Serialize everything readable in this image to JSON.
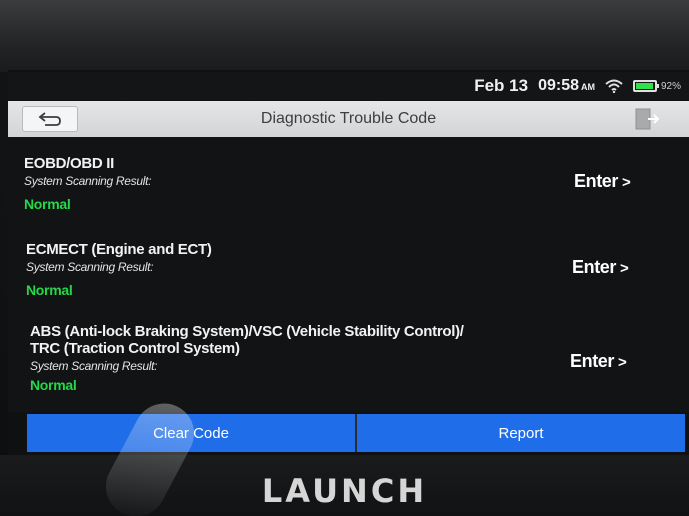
{
  "status_bar": {
    "date": "Feb 13",
    "time": "09:58",
    "ampm": "AM",
    "battery_level": 0.92,
    "battery_text": "92%"
  },
  "header": {
    "title": "Diagnostic Trouble Code"
  },
  "systems": [
    {
      "name_line1": "EOBD/OBD II",
      "name_line2": "",
      "result_label": "System Scanning Result:",
      "status": "Normal",
      "action": "Enter",
      "action_icon": ">"
    },
    {
      "name_line1": "ECMECT (Engine and ECT)",
      "name_line2": "",
      "result_label": "System Scanning Result:",
      "status": "Normal",
      "action": "Enter",
      "action_icon": ">"
    },
    {
      "name_line1": "ABS (Anti-lock Braking System)/VSC (Vehicle Stability Control)/",
      "name_line2": "TRC (Traction Control System)",
      "result_label": "System Scanning Result:",
      "status": "Normal",
      "action": "Enter",
      "action_icon": ">"
    }
  ],
  "footer": {
    "clear_code": "Clear Code",
    "report": "Report"
  },
  "device": {
    "brand": "LAUNCH"
  },
  "colors": {
    "status_ok": "#24d84a",
    "button_blue": "#1f6de8",
    "battery_green": "#2fe04a"
  },
  "icons": {
    "back": "back-arrow-icon",
    "exit": "exit-icon",
    "wifi": "wifi-icon",
    "battery": "battery-icon"
  }
}
